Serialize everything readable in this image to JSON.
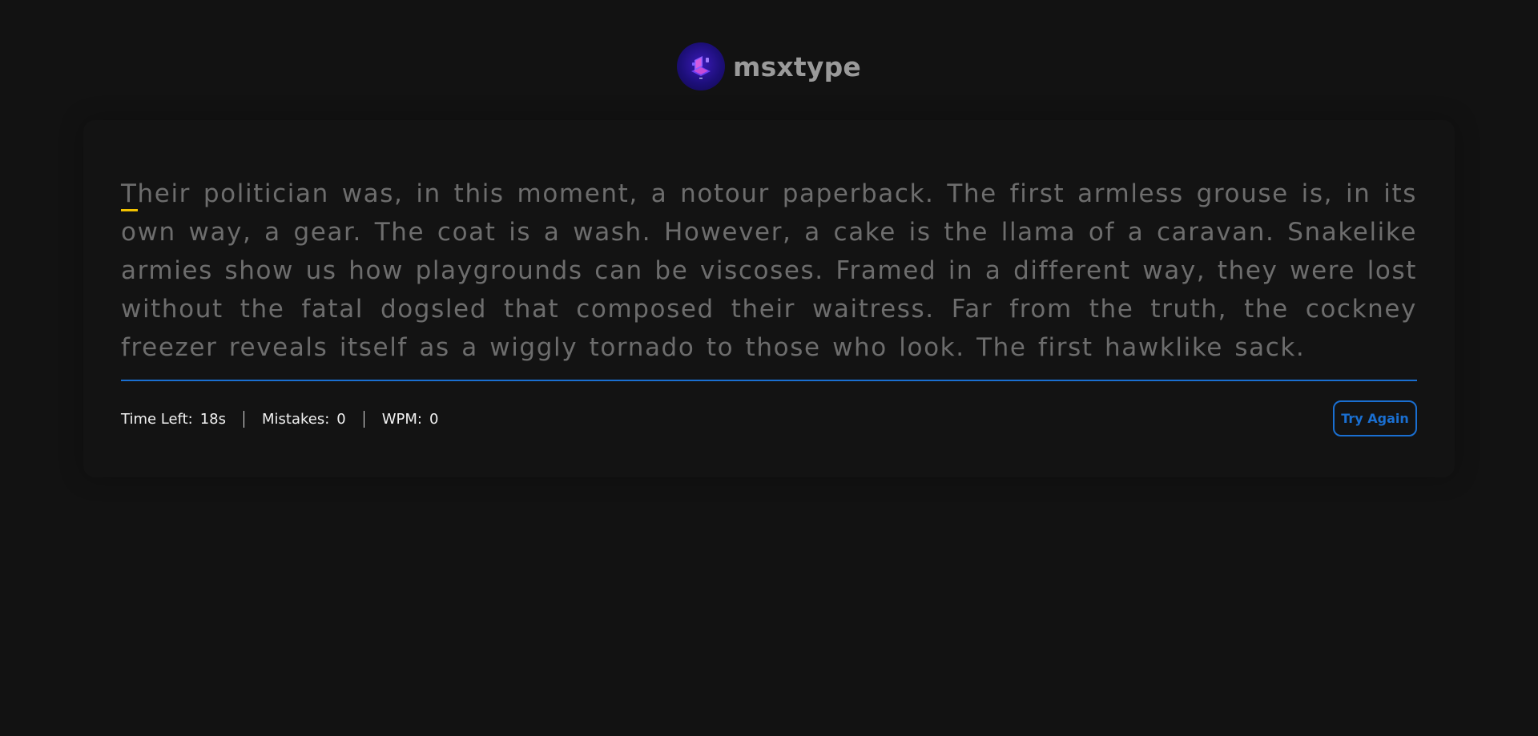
{
  "header": {
    "brand": "msxtype",
    "logo_icon": "laptop-logo-icon"
  },
  "passage": {
    "first_char": "T",
    "rest": "heir politician was, in this moment, a notour paperback. The first armless grouse is, in its own way, a gear. The coat is a wash. However, a cake is the llama of a caravan. Snakelike armies show us how playgrounds can be viscoses. Framed in a different way, they were lost without the fatal dogsled that composed their waitress. Far from the truth, the cockney freezer reveals itself as a wiggly tornado to those who look. The first hawklike sack."
  },
  "stats": {
    "time_label": "Time Left:",
    "time_value": "18s",
    "mistakes_label": "Mistakes:",
    "mistakes_value": "0",
    "wpm_label": "WPM:",
    "wpm_value": "0"
  },
  "actions": {
    "try_again_label": "Try Again"
  },
  "colors": {
    "background": "#121212",
    "accent": "#1a6fd1",
    "caret": "#f2c200",
    "untyped_text": "#6d6d6d",
    "brand_text": "#9a9a9a"
  }
}
